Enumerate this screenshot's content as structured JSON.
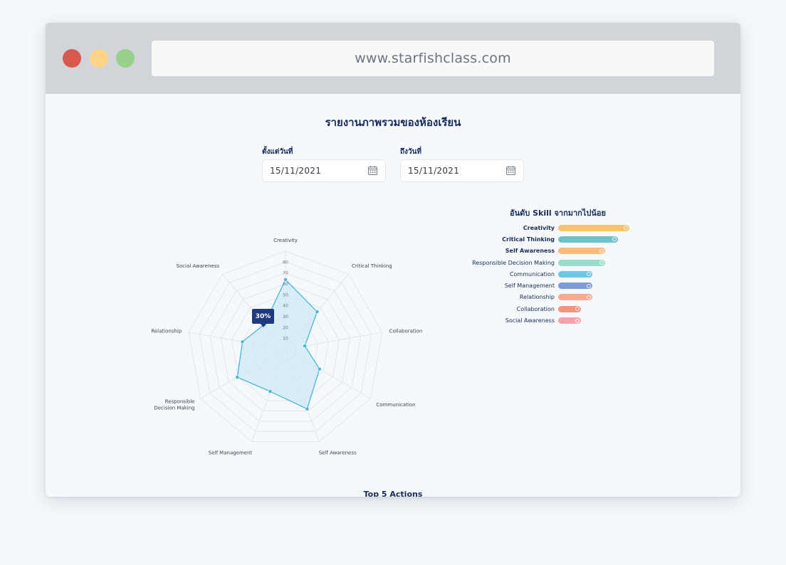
{
  "browser": {
    "url": "www.starfishclass.com",
    "traffic_light_colors": [
      "#d9584e",
      "#fcd588",
      "#98d18e"
    ]
  },
  "page": {
    "title": "รายงานภาพรวมของห้องเรียน",
    "from_label": "ตั้งแต่วันที่",
    "from_value": "15/11/2021",
    "to_label": "ถึงวันที่",
    "to_value": "15/11/2021",
    "actions_title": "Top 5 Actions"
  },
  "chart_data": [
    {
      "type": "radar",
      "title": "",
      "axes": [
        "Creativity",
        "Critical Thinking",
        "Collaboration",
        "Communication",
        "Self Awareness",
        "Self Management",
        "Responsible Decision Making",
        "Relationship",
        "Social Awareness"
      ],
      "axis_label_lines": [
        [
          "Creativity"
        ],
        [
          "Critical Thinking"
        ],
        [
          "Collaboration"
        ],
        [
          "Communication"
        ],
        [
          "Self Awareness"
        ],
        [
          "Self Management"
        ],
        [
          "Responsible",
          "Decision Making"
        ],
        [
          "Relationship"
        ],
        [
          "Social Awareness"
        ]
      ],
      "ticks": [
        10,
        20,
        30,
        40,
        50,
        60,
        70,
        80
      ],
      "range": [
        0,
        80
      ],
      "series": [
        {
          "values": [
            64,
            45,
            18,
            36,
            58,
            41,
            51,
            40,
            30
          ]
        }
      ],
      "tooltip": {
        "axis": "Social Awareness",
        "text": "30%"
      },
      "fill_color": "#cfe8f7",
      "line_color": "#4bb4d8",
      "grid_color": "#e2e6ea"
    },
    {
      "type": "bar",
      "title": "อันดับ Skill จากมากไปน้อย",
      "orientation": "horizontal",
      "categories": [
        "Creativity",
        "Critical Thinking",
        "Self Awareness",
        "Responsible Decision Making",
        "Communication",
        "Self Management",
        "Relationship",
        "Collaboration",
        "Social Awareness"
      ],
      "bold": [
        true,
        true,
        true,
        false,
        false,
        false,
        false,
        false,
        false
      ],
      "values": [
        5,
        4.2,
        3.3,
        3.3,
        2.4,
        2.4,
        2.4,
        1.6,
        1.6
      ],
      "max": 6,
      "colors": [
        "#f6c46c",
        "#6cc4ca",
        "#fbb97a",
        "#98dccd",
        "#6ec6e4",
        "#7d9cd6",
        "#f6aa90",
        "#f3957e",
        "#f4a3ae"
      ]
    }
  ]
}
